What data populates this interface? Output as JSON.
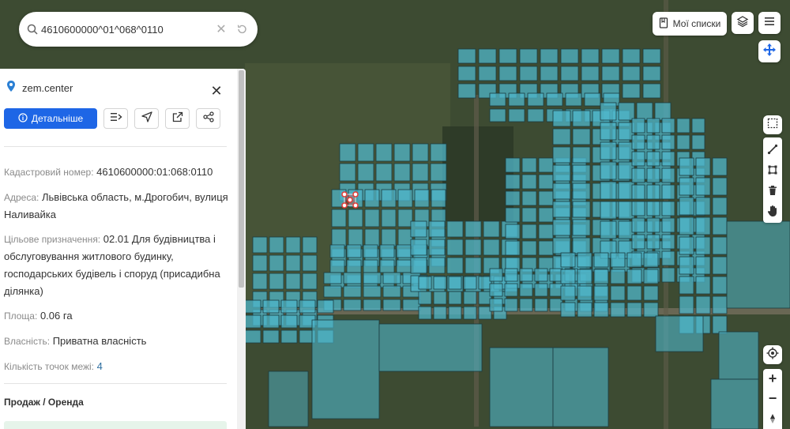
{
  "search": {
    "value": "4610600000^01^068^0110",
    "placeholder": ""
  },
  "top_right": {
    "my_lists_label": "Мої списки"
  },
  "panel": {
    "brand": "zem.center",
    "details_button": "Детальніше",
    "fields": {
      "cadastral_label": "Кадастровий номер:",
      "cadastral_value": "4610600000:01:068:0110",
      "address_label": "Адреса:",
      "address_value": "Львівська область, м.Дрогобич, вулиця Наливайка",
      "purpose_label": "Цільове призначення:",
      "purpose_value": "02.01 Для будівництва і обслуговування житлового будинку, господарських будівель і споруд (присадибна ділянка)",
      "area_label": "Площа:",
      "area_value": "0.06 га",
      "ownership_label": "Власність:",
      "ownership_value": "Приватна власність",
      "points_label": "Кількість точок межі:",
      "points_value": "4"
    },
    "section_title": "Продаж / Оренда"
  },
  "zoom": {
    "in": "+",
    "out": "−"
  },
  "colors": {
    "accent": "#1e66e6",
    "parcel_fill": "#4fb6c9",
    "parcel_stroke": "#1b3b3f",
    "selected": "#e53935"
  },
  "icons": [
    "search-icon",
    "clear-icon",
    "history-icon",
    "bookmark-icon",
    "layers-icon",
    "menu-icon",
    "move-icon",
    "location-pin-icon",
    "close-icon",
    "info-icon",
    "route-icon",
    "navigate-icon",
    "external-link-icon",
    "share-icon",
    "select-area-icon",
    "ruler-icon",
    "polygon-icon",
    "trash-icon",
    "hand-icon",
    "my-location-icon",
    "compass-icon"
  ]
}
